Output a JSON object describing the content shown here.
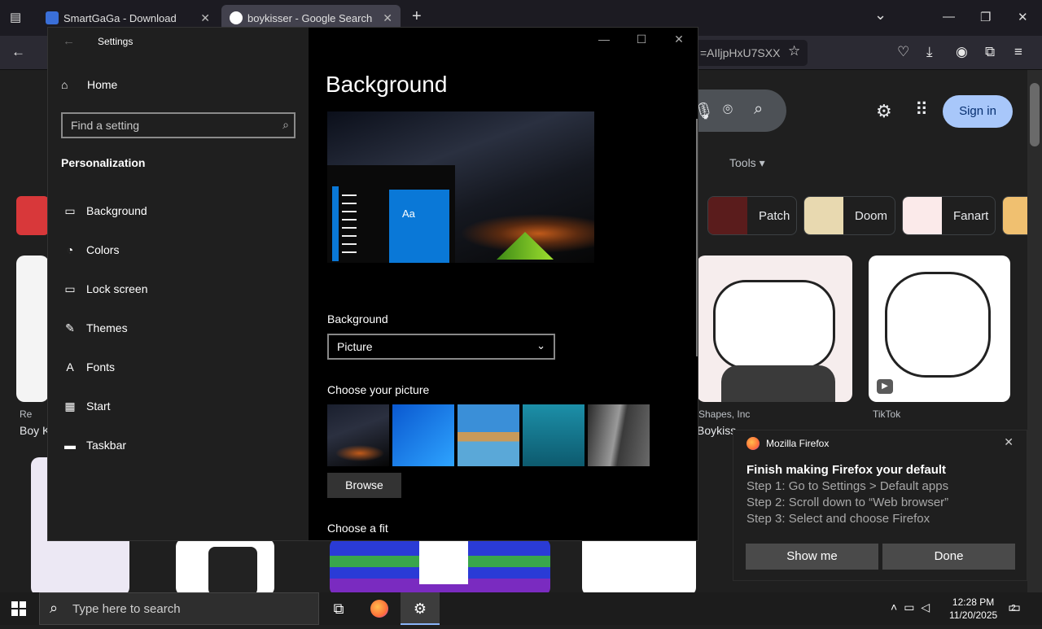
{
  "browser": {
    "tabs": [
      {
        "title": "SmartGaGa - Download",
        "close": "✕"
      },
      {
        "title": "boykisser - Google Search",
        "close": "✕"
      }
    ],
    "new_tab": "+",
    "list_all": "⌄",
    "url_tail": "=AIljpHxU7SXX",
    "window_minimize": "—",
    "window_restore": "❐",
    "window_close": "✕"
  },
  "google": {
    "signin": "Sign in",
    "tools": "Tools ▾",
    "chips": [
      "Patch",
      "Doom",
      "Fanart"
    ],
    "captions": {
      "left_source": "Re",
      "left_title": "Boy K",
      "shapes_source": "Shapes, Inc",
      "shapes_title": "Boykiss",
      "tiktok_source": "TikTok"
    }
  },
  "settings": {
    "app_title": "Settings",
    "back": "←",
    "home": "Home",
    "search_placeholder": "Find a setting",
    "section": "Personalization",
    "nav": [
      {
        "label": "Background",
        "icon": "background-icon",
        "glyph": "▭"
      },
      {
        "label": "Colors",
        "icon": "palette-icon",
        "glyph": "◔"
      },
      {
        "label": "Lock screen",
        "icon": "lock-screen-icon",
        "glyph": "▭"
      },
      {
        "label": "Themes",
        "icon": "themes-icon",
        "glyph": "✎"
      },
      {
        "label": "Fonts",
        "icon": "fonts-icon",
        "glyph": "A"
      },
      {
        "label": "Start",
        "icon": "start-icon",
        "glyph": "▦"
      },
      {
        "label": "Taskbar",
        "icon": "taskbar-icon",
        "glyph": "▬"
      }
    ],
    "page_title": "Background",
    "preview_tile": "Aa",
    "background_label": "Background",
    "background_value": "Picture",
    "choose_picture": "Choose your picture",
    "browse": "Browse",
    "choose_fit": "Choose a fit",
    "win_minimize": "—",
    "win_maximize": "☐",
    "win_close": "✕"
  },
  "notification": {
    "app": "Mozilla Firefox",
    "close": "✕",
    "title": "Finish making Firefox your default",
    "steps": [
      "Step 1: Go to Settings > Default apps",
      "Step 2: Scroll down to “Web browser”",
      "Step 3: Select and choose Firefox"
    ],
    "show_me": "Show me",
    "done": "Done"
  },
  "taskbar": {
    "search_placeholder": "Type here to search",
    "time": "12:28 PM",
    "date": "11/20/2025",
    "notification_count": "2"
  },
  "colors": {
    "accent_blue": "#0a78d7",
    "signin_bg": "#a8c7fa",
    "firefox_orange": "#ff7139"
  }
}
